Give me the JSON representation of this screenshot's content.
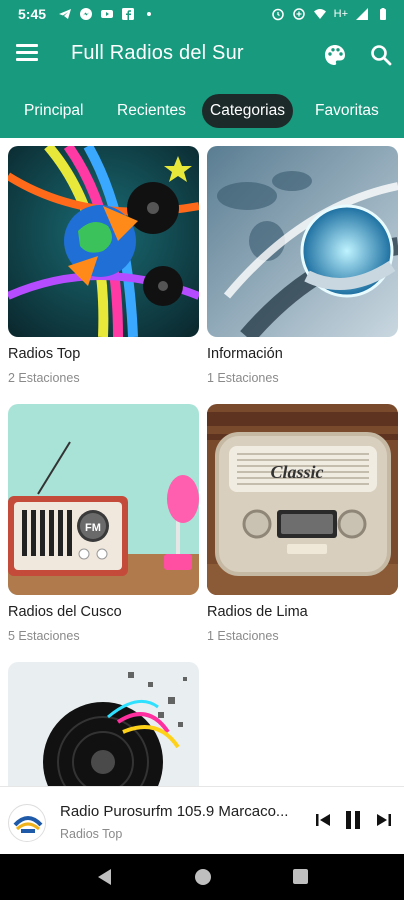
{
  "status_bar": {
    "time": "5:45",
    "network_label": "H+"
  },
  "app_bar": {
    "title": "Full Radios del Sur"
  },
  "tabs": [
    {
      "label": "Principal",
      "active": false
    },
    {
      "label": "Recientes",
      "active": false
    },
    {
      "label": "Categorias",
      "active": true
    },
    {
      "label": "Favoritas",
      "active": false
    }
  ],
  "categories": [
    {
      "name": "Radios Top",
      "count": "2 Estaciones"
    },
    {
      "name": "Información",
      "count": "1 Estaciones"
    },
    {
      "name": "Radios del Cusco",
      "count": "5 Estaciones"
    },
    {
      "name": "Radios de Lima",
      "count": "1 Estaciones"
    },
    {
      "name": "",
      "count": ""
    }
  ],
  "card_images": {
    "radios_top_art": "Classic",
    "radio_fm_badge": "FM"
  },
  "player": {
    "title": "Radio Purosurfm 105.9 Marcaco...",
    "subtitle": "Radios Top"
  },
  "colors": {
    "primary": "#189a7e",
    "active_tab": "#1d2a2a",
    "navbar": "#000000"
  }
}
